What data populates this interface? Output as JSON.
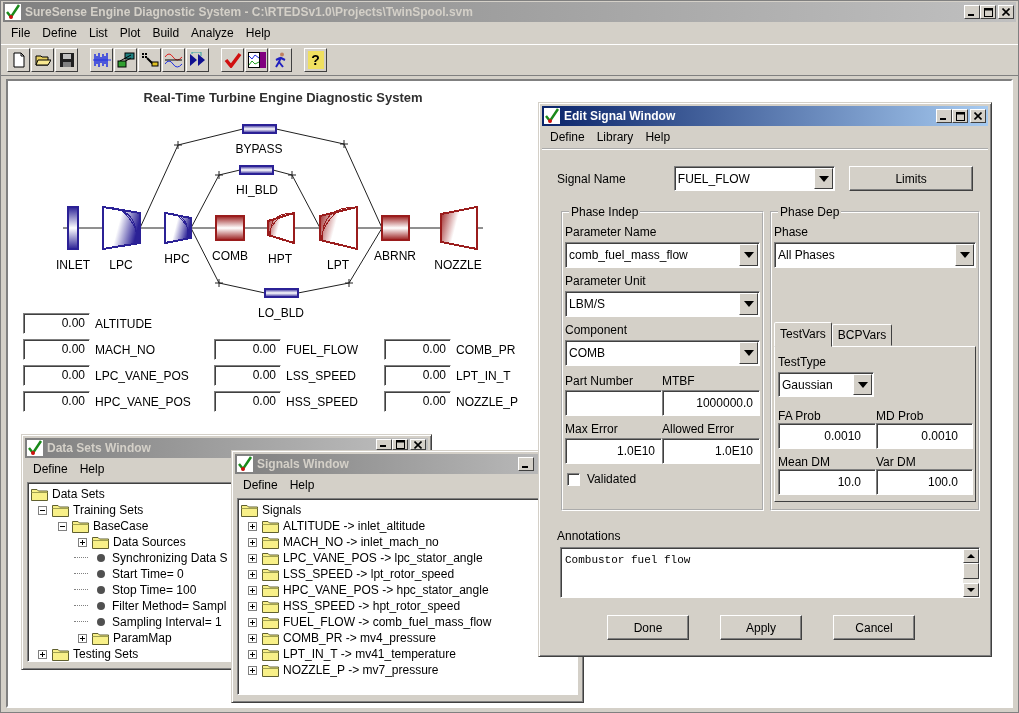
{
  "window": {
    "title": "SureSense Engine Diagnostic System - C:\\RTEDSv1.0\\Projects\\TwinSpool.svm",
    "active": false
  },
  "menu": [
    "File",
    "Define",
    "List",
    "Plot",
    "Build",
    "Analyze",
    "Help"
  ],
  "toolbar": {
    "help_glyph": "?"
  },
  "diagram": {
    "title": "Real-Time Turbine Engine Diagnostic System",
    "components": [
      {
        "label": "INLET",
        "kind": "inlet",
        "color": "#2b2196"
      },
      {
        "label": "LPC",
        "kind": "compressor",
        "color": "#2b2196"
      },
      {
        "label": "HPC",
        "kind": "compressor",
        "color": "#2b2196"
      },
      {
        "label": "COMB",
        "kind": "chamber",
        "color": "#9a1c1c"
      },
      {
        "label": "HPT",
        "kind": "turbine",
        "color": "#9a1c1c"
      },
      {
        "label": "LPT",
        "kind": "turbine",
        "color": "#9a1c1c"
      },
      {
        "label": "ABRNR",
        "kind": "chamber",
        "color": "#9a1c1c"
      },
      {
        "label": "NOZZLE",
        "kind": "nozzle",
        "color": "#9a1c1c"
      },
      {
        "label": "BYPASS",
        "kind": "bleed",
        "color": "#2b2196"
      },
      {
        "label": "HI_BLD",
        "kind": "bleed",
        "color": "#2b2196"
      },
      {
        "label": "LO_BLD",
        "kind": "bleed",
        "color": "#2b2196"
      }
    ]
  },
  "readouts": [
    [
      {
        "value": "0.00",
        "label": "ALTITUDE"
      },
      {
        "value": "0.00",
        "label": "MACH_NO"
      },
      {
        "value": "0.00",
        "label": "LPC_VANE_POS"
      },
      {
        "value": "0.00",
        "label": "HPC_VANE_POS"
      }
    ],
    [
      {
        "value": "0.00",
        "label": "FUEL_FLOW"
      },
      {
        "value": "0.00",
        "label": "LSS_SPEED"
      },
      {
        "value": "0.00",
        "label": "HSS_SPEED"
      }
    ],
    [
      {
        "value": "0.00",
        "label": "COMB_PR"
      },
      {
        "value": "0.00",
        "label": "LPT_IN_T"
      },
      {
        "value": "0.00",
        "label": "NOZZLE_P"
      }
    ]
  ],
  "data_sets_window": {
    "title": "Data Sets Window",
    "active": false,
    "menu": [
      "Define",
      "Help"
    ],
    "tree": {
      "label": "Data Sets",
      "kind": "folder",
      "children": [
        {
          "label": "Training Sets",
          "kind": "folder",
          "expanded": true,
          "children": [
            {
              "label": "BaseCase",
              "kind": "folder",
              "expanded": true,
              "children": [
                {
                  "label": "Data Sources",
                  "kind": "folder",
                  "expanded": false
                },
                {
                  "label": "Synchronizing Data S",
                  "kind": "property"
                },
                {
                  "label": "Start Time= 0",
                  "kind": "property"
                },
                {
                  "label": "Stop Time= 100",
                  "kind": "property"
                },
                {
                  "label": "Filter Method= Sampl",
                  "kind": "property"
                },
                {
                  "label": "Sampling Interval= 1",
                  "kind": "property"
                },
                {
                  "label": "ParamMap",
                  "kind": "folder",
                  "expanded": false
                }
              ]
            }
          ]
        },
        {
          "label": "Testing Sets",
          "kind": "folder",
          "expanded": false
        }
      ]
    }
  },
  "signals_window": {
    "title": "Signals Window",
    "active": false,
    "menu": [
      "Define",
      "Help"
    ],
    "tree": {
      "label": "Signals",
      "kind": "folder",
      "children": [
        {
          "label": "ALTITUDE -> inlet_altitude",
          "kind": "folder",
          "expanded": false
        },
        {
          "label": "MACH_NO -> inlet_mach_no",
          "kind": "folder",
          "expanded": false
        },
        {
          "label": "LPC_VANE_POS -> lpc_stator_angle",
          "kind": "folder",
          "expanded": false
        },
        {
          "label": "LSS_SPEED -> lpt_rotor_speed",
          "kind": "folder",
          "expanded": false
        },
        {
          "label": "HPC_VANE_POS -> hpc_stator_angle",
          "kind": "folder",
          "expanded": false
        },
        {
          "label": "HSS_SPEED -> hpt_rotor_speed",
          "kind": "folder",
          "expanded": false
        },
        {
          "label": "FUEL_FLOW -> comb_fuel_mass_flow",
          "kind": "folder",
          "expanded": false
        },
        {
          "label": "COMB_PR -> mv4_pressure",
          "kind": "folder",
          "expanded": false
        },
        {
          "label": "LPT_IN_T -> mv41_temperature",
          "kind": "folder",
          "expanded": false
        },
        {
          "label": "NOZZLE_P -> mv7_pressure",
          "kind": "folder",
          "expanded": false
        }
      ]
    }
  },
  "edit_signal_window": {
    "title": "Edit Signal Window",
    "active": true,
    "menu": [
      "Define",
      "Library",
      "Help"
    ],
    "signal_name": {
      "label": "Signal Name",
      "value": "FUEL_FLOW"
    },
    "limits_button": "Limits",
    "phase_indep": {
      "title": "Phase Indep",
      "dropdowns": [
        {
          "label": "Parameter Name",
          "value": "comb_fuel_mass_flow"
        },
        {
          "label": "Parameter Unit",
          "value": "LBM/S"
        },
        {
          "label": "Component",
          "value": "COMB"
        }
      ],
      "fields": [
        {
          "label": "Part Number"
        },
        {
          "label": "MTBF",
          "value": "1000000.0"
        },
        {
          "label": "Max Error",
          "value": "1.0E10"
        },
        {
          "label": "Allowed Error",
          "value": "1.0E10"
        }
      ],
      "validated": {
        "label": "Validated",
        "checked": false
      }
    },
    "phase_dep": {
      "title": "Phase Dep",
      "phase": {
        "label": "Phase",
        "value": "All Phases"
      },
      "tabs": [
        {
          "label": "TestVars",
          "selected": true
        },
        {
          "label": "BCPVars",
          "selected": false
        }
      ],
      "test_type": {
        "label": "TestType",
        "value": "Gaussian"
      },
      "fields": [
        {
          "label": "FA Prob",
          "value": "0.0010"
        },
        {
          "label": "MD Prob",
          "value": "0.0010"
        },
        {
          "label": "Mean DM",
          "value": "10.0"
        },
        {
          "label": "Var DM",
          "value": "100.0"
        }
      ]
    },
    "annotations": {
      "label": "Annotations",
      "value": "Combustor fuel flow"
    },
    "buttons": [
      "Done",
      "Apply",
      "Cancel"
    ]
  }
}
